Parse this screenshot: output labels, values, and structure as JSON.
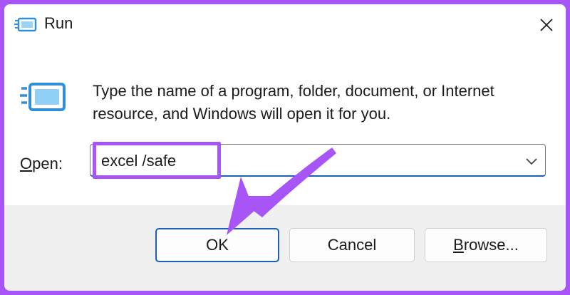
{
  "window": {
    "title": "Run",
    "close_icon": "close-icon",
    "app_icon": "run-icon"
  },
  "content": {
    "description": "Type the name of a program, folder, document, or Internet resource, and Windows will open it for you.",
    "big_icon": "run-icon"
  },
  "open_field": {
    "label_accel": "O",
    "label_rest": "pen:",
    "value": "excel /safe",
    "dropdown_icon": "chevron-down-icon"
  },
  "buttons": {
    "ok": "OK",
    "cancel": "Cancel",
    "browse_accel": "B",
    "browse_rest": "rowse..."
  },
  "annotation": {
    "highlight_color": "#a855f7",
    "arrow_color": "#a855f7"
  }
}
